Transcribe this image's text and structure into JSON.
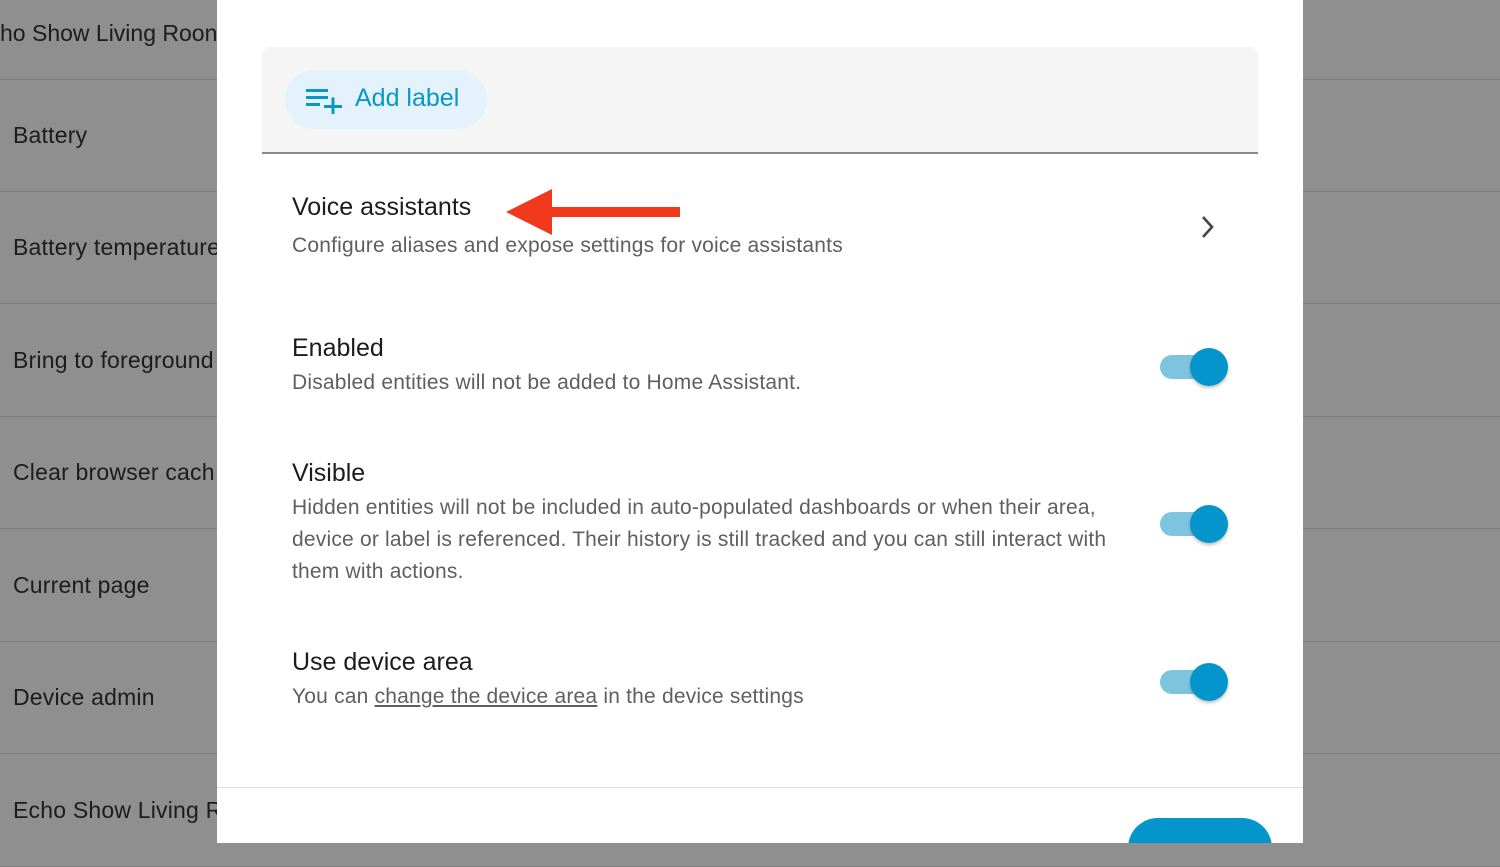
{
  "background": {
    "header_title": "ho Show Living Roon",
    "rows": [
      {
        "label": "Battery"
      },
      {
        "label": "Battery temperature"
      },
      {
        "label": "Bring to foreground"
      },
      {
        "label": "Clear browser cach"
      },
      {
        "label": "Current page"
      },
      {
        "label": "Device admin"
      },
      {
        "label": "Echo Show Living R"
      }
    ]
  },
  "dialog": {
    "labels": {
      "add_label": "Add label",
      "icon": "playlist-add-icon"
    },
    "voice_assistants": {
      "title": "Voice assistants",
      "description": "Configure aliases and expose settings for voice assistants",
      "icon": "chevron-right-icon"
    },
    "annotation": {
      "icon": "red-arrow-icon",
      "color": "#f1391d"
    },
    "enabled": {
      "title": "Enabled",
      "description": "Disabled entities will not be added to Home Assistant.",
      "on": true
    },
    "visible": {
      "title": "Visible",
      "description": "Hidden entities will not be included in auto-populated dashboards or when their area, device or label is referenced. Their history is still tracked and you can still interact with them with actions.",
      "on": true
    },
    "device_area": {
      "title": "Use device area",
      "description_before": "You can ",
      "link_text": "change the device area",
      "description_after": " in the device settings",
      "on": true
    }
  },
  "colors": {
    "accent": "#0395cb",
    "toggle_track": "#7fc4df",
    "chip_background": "#e3f2fb",
    "overlay": "#8f8f8f"
  }
}
